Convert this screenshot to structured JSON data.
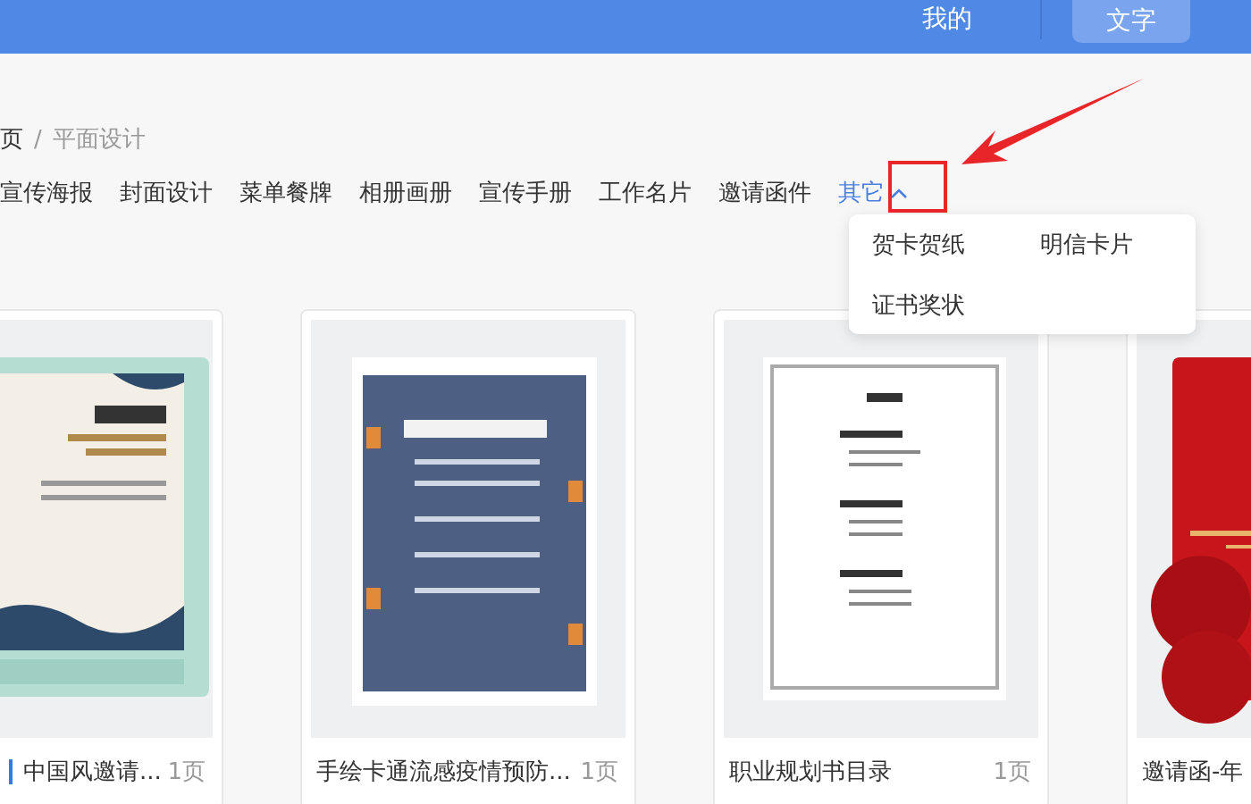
{
  "top_bar": {
    "items": [
      {
        "label": "我的",
        "selected": false
      },
      {
        "label": "文字",
        "selected": true
      }
    ]
  },
  "breadcrumb": {
    "items": [
      "页",
      "平面设计"
    ],
    "separator": "/"
  },
  "categories": [
    {
      "label": "宣传海报",
      "selected": false
    },
    {
      "label": "封面设计",
      "selected": false
    },
    {
      "label": "菜单餐牌",
      "selected": false
    },
    {
      "label": "相册画册",
      "selected": false
    },
    {
      "label": "宣传手册",
      "selected": false
    },
    {
      "label": "工作名片",
      "selected": false
    },
    {
      "label": "邀请函件",
      "selected": false
    }
  ],
  "more": {
    "label": "其它",
    "expanded": true
  },
  "dropdown": {
    "items": [
      "贺卡贺纸",
      "明信卡片",
      "证书奖状"
    ]
  },
  "cards": [
    {
      "title": "中国风邀请...",
      "pages": "1页",
      "marked": true
    },
    {
      "title": "手绘卡通流感疫情预防...",
      "pages": "1页",
      "marked": false
    },
    {
      "title": "职业规划书目录",
      "pages": "1页",
      "marked": false
    },
    {
      "title": "邀请函-年",
      "marked": false
    }
  ],
  "annotations": {
    "highlight_box": true,
    "arrow": true
  }
}
